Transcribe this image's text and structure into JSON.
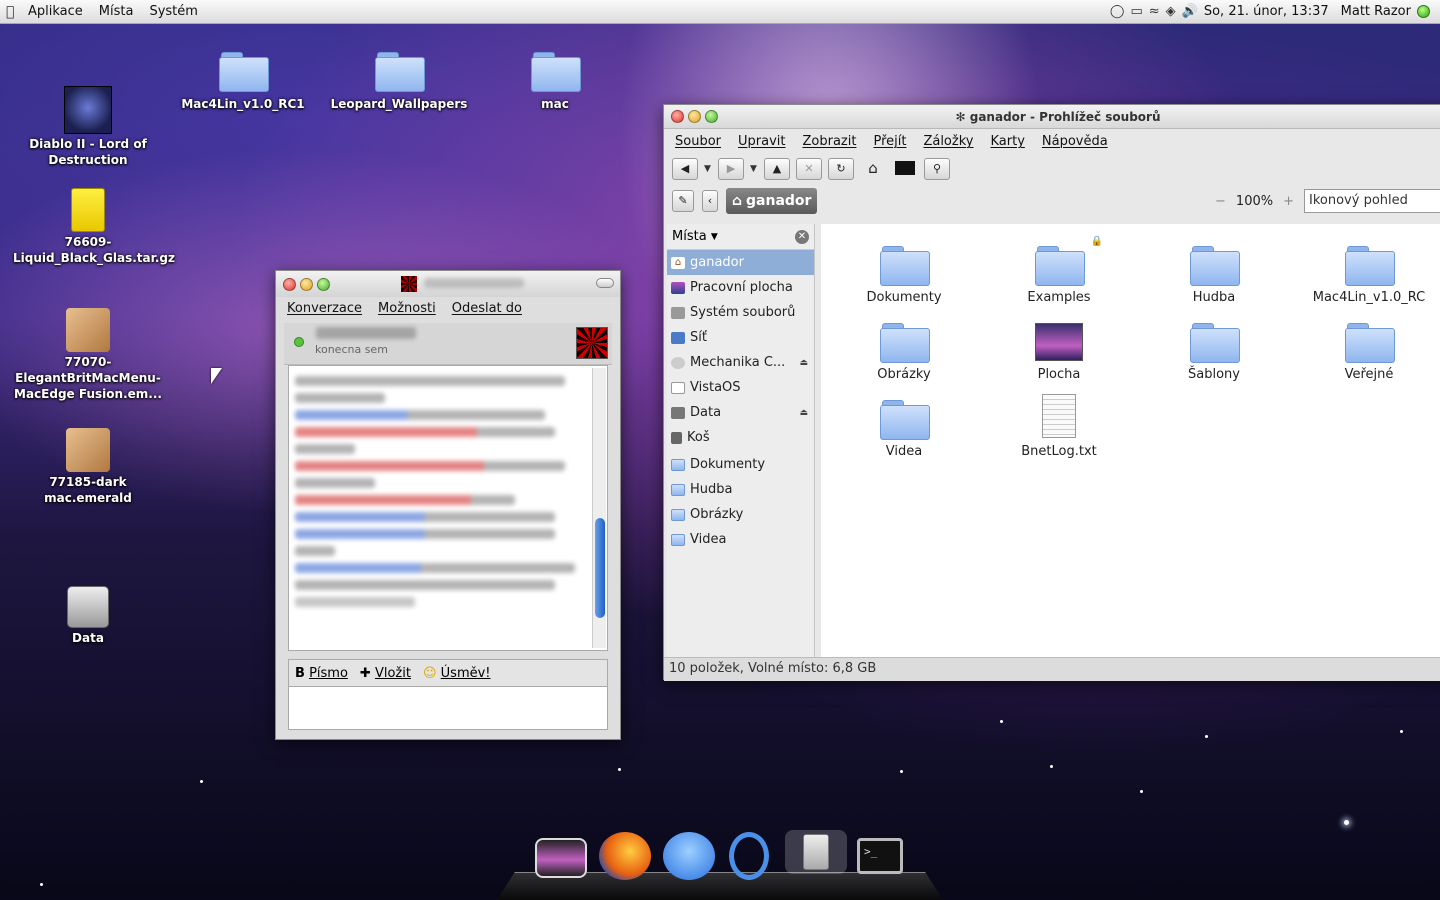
{
  "panel": {
    "menus": [
      "Aplikace",
      "Místa",
      "Systém"
    ],
    "datetime": "So, 21. únor, 13:37",
    "user": "Matt Razor"
  },
  "desktop_icons": [
    {
      "label": "Diablo II - Lord of Destruction",
      "icon": "game-icon"
    },
    {
      "label": "76609-Liquid_Black_Glas.tar.gz",
      "icon": "archive-icon"
    },
    {
      "label": "77070-ElegantBritMacMenu-MacEdge Fusion.em...",
      "icon": "package-icon"
    },
    {
      "label": "77185-dark mac.emerald",
      "icon": "package-icon"
    },
    {
      "label": "Data",
      "icon": "drive-icon"
    },
    {
      "label": "Mac4Lin_v1.0_RC1",
      "icon": "folder-icon"
    },
    {
      "label": "Leopard_Wallpapers",
      "icon": "folder-icon"
    },
    {
      "label": "mac",
      "icon": "folder-icon"
    }
  ],
  "chat": {
    "menus": [
      "Konverzace",
      "Možnosti",
      "Odeslat do"
    ],
    "buddy_status": "konecna sem",
    "format_bar": [
      "Písmo",
      "Vložit",
      "Úsměv!"
    ]
  },
  "filemanager": {
    "title": "ganador - Prohlížeč souborů",
    "menus": [
      "Soubor",
      "Upravit",
      "Zobrazit",
      "Přejít",
      "Záložky",
      "Karty",
      "Nápověda"
    ],
    "location": "ganador",
    "zoom": "100%",
    "view_mode": "Ikonový pohled",
    "sidebar_header": "Místa",
    "places": [
      {
        "label": "ganador",
        "selected": true
      },
      {
        "label": "Pracovní plocha"
      },
      {
        "label": "Systém souborů"
      },
      {
        "label": "Síť"
      },
      {
        "label": "Mechanika C...",
        "eject": true
      },
      {
        "label": "VistaOS"
      },
      {
        "label": "Data",
        "eject": true
      },
      {
        "label": "Koš"
      }
    ],
    "bookmarks": [
      "Dokumenty",
      "Hudba",
      "Obrázky",
      "Videa"
    ],
    "files": [
      "Dokumenty",
      "Examples",
      "Hudba",
      "Mac4Lin_v1.0_RC",
      "Obrázky",
      "Plocha",
      "Šablony",
      "Veřejné",
      "Videa",
      "BnetLog.txt"
    ],
    "status": "10 položek, Volné místo: 6,8 GB"
  },
  "dock": [
    "image-viewer-icon",
    "firefox-icon",
    "chat-icon",
    "beagle-search-icon",
    "file-cabinet-icon",
    "terminal-icon"
  ]
}
